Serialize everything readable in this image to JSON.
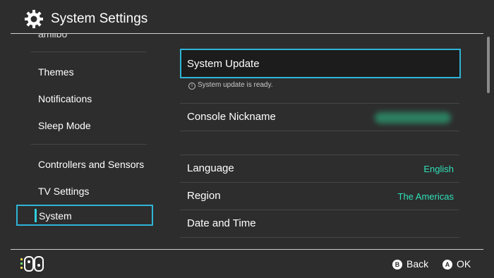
{
  "header": {
    "title": "System Settings",
    "icon": "gear-icon"
  },
  "sidebar": {
    "cut_item": "amiibo",
    "items": [
      "Themes",
      "Notifications",
      "Sleep Mode",
      "Controllers and Sensors",
      "TV Settings"
    ],
    "selected": "System"
  },
  "main": {
    "system_update": "System Update",
    "update_note": "System update is ready.",
    "console_nickname": "Console Nickname",
    "language": {
      "label": "Language",
      "value": "English"
    },
    "region": {
      "label": "Region",
      "value": "The Americas"
    },
    "date_time": "Date and Time"
  },
  "footer": {
    "back": {
      "key": "B",
      "label": "Back"
    },
    "ok": {
      "key": "A",
      "label": "OK"
    }
  },
  "colors": {
    "accent": "#2fb4d6",
    "value": "#2fe0b8",
    "background": "#2d2d2d"
  }
}
